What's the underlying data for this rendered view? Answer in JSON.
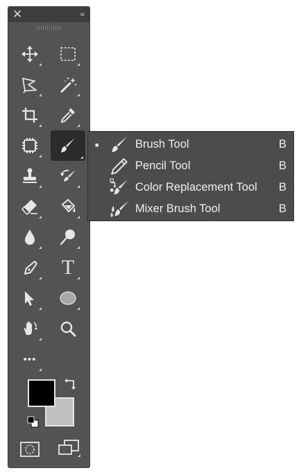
{
  "toolbar": {
    "close_glyph": "✕",
    "collapse_glyph": "‹‹",
    "tools": [
      {
        "name": "move-tool",
        "icon": "move-icon"
      },
      {
        "name": "marquee-tool",
        "icon": "rect-marquee-icon"
      },
      {
        "name": "lasso-tool",
        "icon": "polygonal-lasso-icon"
      },
      {
        "name": "magic-wand-tool",
        "icon": "magic-wand-icon"
      },
      {
        "name": "crop-tool",
        "icon": "crop-icon"
      },
      {
        "name": "eyedropper-tool",
        "icon": "eyedropper-icon"
      },
      {
        "name": "healing-brush-tool",
        "icon": "patch-icon"
      },
      {
        "name": "brush-tool",
        "icon": "brush-icon",
        "active": true
      },
      {
        "name": "clone-stamp-tool",
        "icon": "stamp-icon"
      },
      {
        "name": "history-brush-tool",
        "icon": "history-brush-icon"
      },
      {
        "name": "eraser-tool",
        "icon": "eraser-icon"
      },
      {
        "name": "paint-bucket-tool",
        "icon": "bucket-icon"
      },
      {
        "name": "blur-tool",
        "icon": "drop-icon"
      },
      {
        "name": "dodge-tool",
        "icon": "dodge-icon"
      },
      {
        "name": "pen-tool",
        "icon": "pen-icon"
      },
      {
        "name": "type-tool",
        "icon": "type-icon",
        "glyph": "T"
      },
      {
        "name": "path-selection-tool",
        "icon": "arrow-icon"
      },
      {
        "name": "ellipse-tool",
        "icon": "ellipse-icon"
      },
      {
        "name": "hand-tool",
        "icon": "hand-icon"
      },
      {
        "name": "zoom-tool",
        "icon": "magnifier-icon"
      },
      {
        "name": "edit-toolbar",
        "icon": "more-icon",
        "glyph": "•••"
      }
    ],
    "colors": {
      "foreground": "#000000",
      "background": "#c0c0c0"
    }
  },
  "flyout": {
    "items": [
      {
        "label": "Brush Tool",
        "shortcut": "B",
        "selected": true,
        "icon": "brush-icon"
      },
      {
        "label": "Pencil Tool",
        "shortcut": "B",
        "selected": false,
        "icon": "pencil-icon"
      },
      {
        "label": "Color Replacement Tool",
        "shortcut": "B",
        "selected": false,
        "icon": "color-replacement-icon"
      },
      {
        "label": "Mixer Brush Tool",
        "shortcut": "B",
        "selected": false,
        "icon": "mixer-brush-icon"
      }
    ],
    "selected_marker": "■"
  }
}
